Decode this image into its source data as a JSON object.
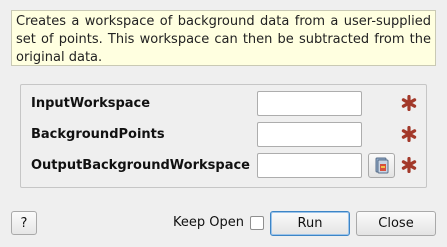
{
  "description": "Creates a workspace of background data from a user-supplied set of points. This workspace can then be subtracted from the original data.",
  "properties": [
    {
      "label": "InputWorkspace",
      "value": "",
      "required": true
    },
    {
      "label": "BackgroundPoints",
      "value": "",
      "required": true
    },
    {
      "label": "OutputBackgroundWorkspace",
      "value": "",
      "required": true
    }
  ],
  "footer": {
    "help_label": "?",
    "keep_open_label": "Keep Open",
    "keep_open_checked": false,
    "run_label": "Run",
    "close_label": "Close"
  },
  "colors": {
    "description_bg": "#ffffe0",
    "required_star": "#a3392a",
    "run_border": "#3d85c6"
  },
  "icons": {
    "browse": "workspace-browse-icon",
    "required": "required-star-icon"
  }
}
